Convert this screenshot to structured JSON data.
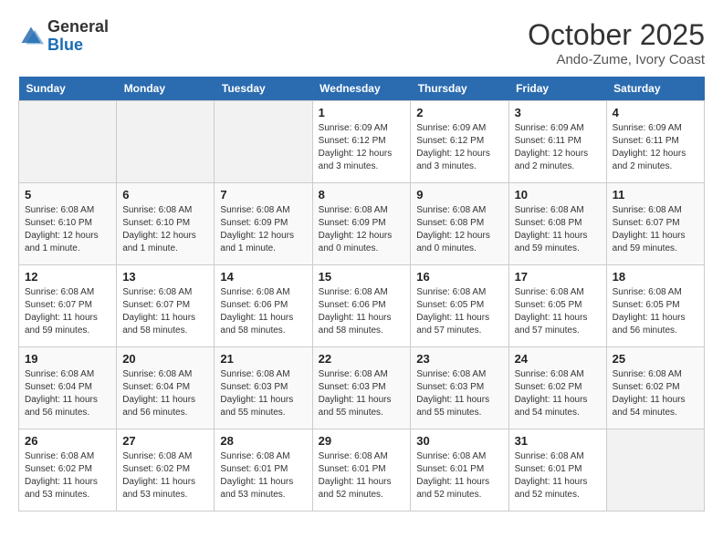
{
  "header": {
    "logo_general": "General",
    "logo_blue": "Blue",
    "month_title": "October 2025",
    "location": "Ando-Zume, Ivory Coast"
  },
  "weekdays": [
    "Sunday",
    "Monday",
    "Tuesday",
    "Wednesday",
    "Thursday",
    "Friday",
    "Saturday"
  ],
  "weeks": [
    [
      {
        "day": "",
        "info": ""
      },
      {
        "day": "",
        "info": ""
      },
      {
        "day": "",
        "info": ""
      },
      {
        "day": "1",
        "info": "Sunrise: 6:09 AM\nSunset: 6:12 PM\nDaylight: 12 hours and 3 minutes."
      },
      {
        "day": "2",
        "info": "Sunrise: 6:09 AM\nSunset: 6:12 PM\nDaylight: 12 hours and 3 minutes."
      },
      {
        "day": "3",
        "info": "Sunrise: 6:09 AM\nSunset: 6:11 PM\nDaylight: 12 hours and 2 minutes."
      },
      {
        "day": "4",
        "info": "Sunrise: 6:09 AM\nSunset: 6:11 PM\nDaylight: 12 hours and 2 minutes."
      }
    ],
    [
      {
        "day": "5",
        "info": "Sunrise: 6:08 AM\nSunset: 6:10 PM\nDaylight: 12 hours and 1 minute."
      },
      {
        "day": "6",
        "info": "Sunrise: 6:08 AM\nSunset: 6:10 PM\nDaylight: 12 hours and 1 minute."
      },
      {
        "day": "7",
        "info": "Sunrise: 6:08 AM\nSunset: 6:09 PM\nDaylight: 12 hours and 1 minute."
      },
      {
        "day": "8",
        "info": "Sunrise: 6:08 AM\nSunset: 6:09 PM\nDaylight: 12 hours and 0 minutes."
      },
      {
        "day": "9",
        "info": "Sunrise: 6:08 AM\nSunset: 6:08 PM\nDaylight: 12 hours and 0 minutes."
      },
      {
        "day": "10",
        "info": "Sunrise: 6:08 AM\nSunset: 6:08 PM\nDaylight: 11 hours and 59 minutes."
      },
      {
        "day": "11",
        "info": "Sunrise: 6:08 AM\nSunset: 6:07 PM\nDaylight: 11 hours and 59 minutes."
      }
    ],
    [
      {
        "day": "12",
        "info": "Sunrise: 6:08 AM\nSunset: 6:07 PM\nDaylight: 11 hours and 59 minutes."
      },
      {
        "day": "13",
        "info": "Sunrise: 6:08 AM\nSunset: 6:07 PM\nDaylight: 11 hours and 58 minutes."
      },
      {
        "day": "14",
        "info": "Sunrise: 6:08 AM\nSunset: 6:06 PM\nDaylight: 11 hours and 58 minutes."
      },
      {
        "day": "15",
        "info": "Sunrise: 6:08 AM\nSunset: 6:06 PM\nDaylight: 11 hours and 58 minutes."
      },
      {
        "day": "16",
        "info": "Sunrise: 6:08 AM\nSunset: 6:05 PM\nDaylight: 11 hours and 57 minutes."
      },
      {
        "day": "17",
        "info": "Sunrise: 6:08 AM\nSunset: 6:05 PM\nDaylight: 11 hours and 57 minutes."
      },
      {
        "day": "18",
        "info": "Sunrise: 6:08 AM\nSunset: 6:05 PM\nDaylight: 11 hours and 56 minutes."
      }
    ],
    [
      {
        "day": "19",
        "info": "Sunrise: 6:08 AM\nSunset: 6:04 PM\nDaylight: 11 hours and 56 minutes."
      },
      {
        "day": "20",
        "info": "Sunrise: 6:08 AM\nSunset: 6:04 PM\nDaylight: 11 hours and 56 minutes."
      },
      {
        "day": "21",
        "info": "Sunrise: 6:08 AM\nSunset: 6:03 PM\nDaylight: 11 hours and 55 minutes."
      },
      {
        "day": "22",
        "info": "Sunrise: 6:08 AM\nSunset: 6:03 PM\nDaylight: 11 hours and 55 minutes."
      },
      {
        "day": "23",
        "info": "Sunrise: 6:08 AM\nSunset: 6:03 PM\nDaylight: 11 hours and 55 minutes."
      },
      {
        "day": "24",
        "info": "Sunrise: 6:08 AM\nSunset: 6:02 PM\nDaylight: 11 hours and 54 minutes."
      },
      {
        "day": "25",
        "info": "Sunrise: 6:08 AM\nSunset: 6:02 PM\nDaylight: 11 hours and 54 minutes."
      }
    ],
    [
      {
        "day": "26",
        "info": "Sunrise: 6:08 AM\nSunset: 6:02 PM\nDaylight: 11 hours and 53 minutes."
      },
      {
        "day": "27",
        "info": "Sunrise: 6:08 AM\nSunset: 6:02 PM\nDaylight: 11 hours and 53 minutes."
      },
      {
        "day": "28",
        "info": "Sunrise: 6:08 AM\nSunset: 6:01 PM\nDaylight: 11 hours and 53 minutes."
      },
      {
        "day": "29",
        "info": "Sunrise: 6:08 AM\nSunset: 6:01 PM\nDaylight: 11 hours and 52 minutes."
      },
      {
        "day": "30",
        "info": "Sunrise: 6:08 AM\nSunset: 6:01 PM\nDaylight: 11 hours and 52 minutes."
      },
      {
        "day": "31",
        "info": "Sunrise: 6:08 AM\nSunset: 6:01 PM\nDaylight: 11 hours and 52 minutes."
      },
      {
        "day": "",
        "info": ""
      }
    ]
  ]
}
